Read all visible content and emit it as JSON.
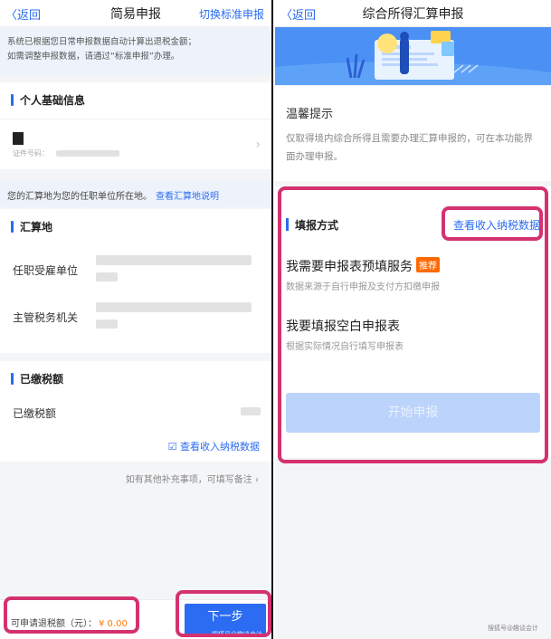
{
  "left": {
    "header": {
      "back_label": "返回",
      "title": "简易申报",
      "action_label": "切换标准申报"
    },
    "notice": {
      "line1": "系统已根据您日常申报数据自动计算出退税金额；",
      "line2": "如需调整申报数据，请通过“标准申报”办理。"
    },
    "personal": {
      "heading": "个人基础信息",
      "id_label": "证件号码："
    },
    "location_info": {
      "text": "您的汇算地为您的任职单位所在地。",
      "link": "查看汇算地说明"
    },
    "settlement": {
      "heading": "汇算地",
      "employer_label": "任职受雇单位",
      "tax_authority_label": "主管税务机关"
    },
    "paid": {
      "heading": "已缴税额",
      "amount_label": "已缴税额",
      "view_link": "查看收入纳税数据"
    },
    "remark_hint": "如有其他补充事项，可填写备注",
    "bottom": {
      "refund_label": "可申请退税额（元）：",
      "refund_amount": "¥ 0.00",
      "next_label": "下一步",
      "watermark": "搜狐号@趣谈会计"
    }
  },
  "right": {
    "header": {
      "back_label": "返回",
      "title": "综合所得汇算申报"
    },
    "tip": {
      "title": "温馨提示",
      "body": "仅取得境内综合所得且需要办理汇算申报的，可在本功能界面办理申报。"
    },
    "method": {
      "heading": "填报方式",
      "view_link": "查看收入纳税数据",
      "option1_title": "我需要申报表预填服务",
      "option1_badge": "推荐",
      "option1_sub": "数据来源于自行申报及支付方扣缴申报",
      "option2_title": "我要填报空白申报表",
      "option2_sub": "根据实际情况自行填写申报表",
      "start_label": "开始申报"
    },
    "watermark": "搜狐号@趣谈会计"
  },
  "colors": {
    "accent": "#2b6cf2",
    "highlight": "#d4326f",
    "badge": "#ff6a00",
    "refund": "#ff7a00"
  }
}
